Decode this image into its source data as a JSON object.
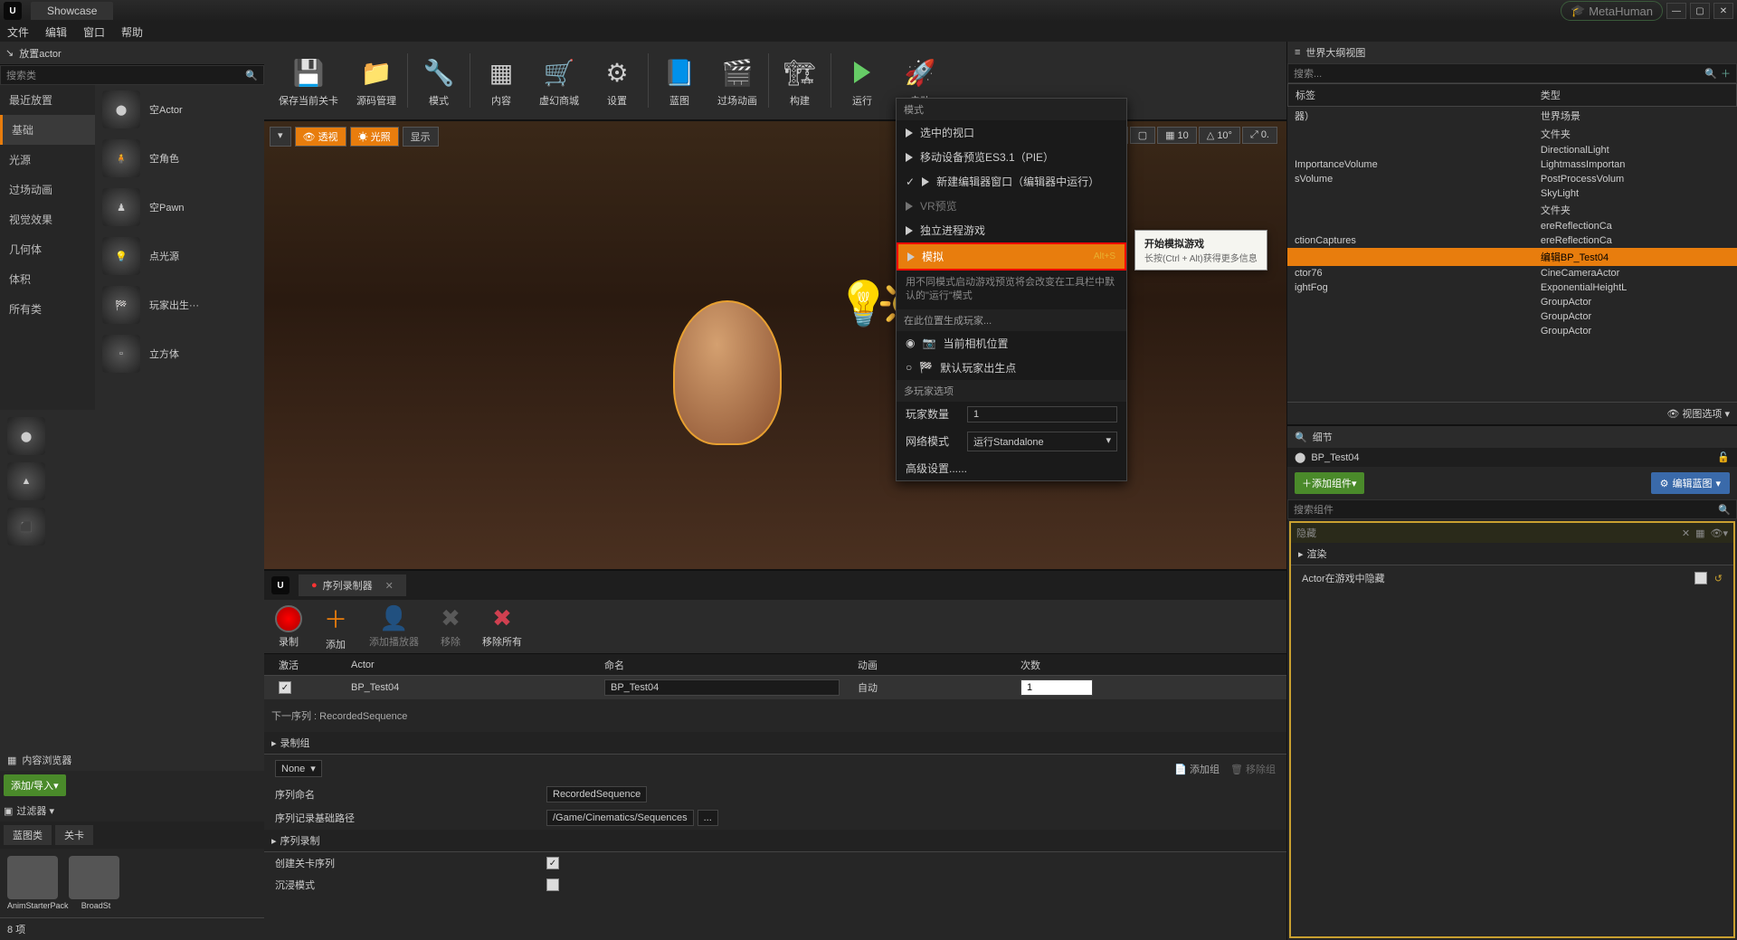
{
  "titlebar": {
    "tab": "Showcase",
    "metahuman": "MetaHuman"
  },
  "menubar": {
    "file": "文件",
    "edit": "编辑",
    "window": "窗口",
    "help": "帮助"
  },
  "place_actor": {
    "title": "放置actor",
    "search_placeholder": "搜索类",
    "categories": {
      "recent": "最近放置",
      "basic": "基础",
      "lights": "光源",
      "cinematic": "过场动画",
      "visual_fx": "视觉效果",
      "geometry": "几何体",
      "volumes": "体积",
      "all": "所有类"
    },
    "actors": {
      "empty_actor": "空Actor",
      "empty_character": "空角色",
      "empty_pawn": "空Pawn",
      "point_light": "点光源",
      "player_start": "玩家出生···",
      "cube": "立方体"
    }
  },
  "toolbar": {
    "save": "保存当前关卡",
    "source": "源码管理",
    "mode": "模式",
    "content": "内容",
    "marketplace": "虚幻商城",
    "settings": "设置",
    "blueprint": "蓝图",
    "cinematic": "过场动画",
    "build": "构建",
    "play": "运行",
    "launch": "启动"
  },
  "viewport": {
    "perspective": "透视",
    "lighting": "光照",
    "show": "显示",
    "snap_angle": "10°",
    "snap_grid": "10",
    "snap_scale": "0."
  },
  "play_menu": {
    "mode_section": "模式",
    "selected_viewport": "选中的视口",
    "mobile_preview": "移动设备预览ES3.1（PIE）",
    "new_editor_window": "新建编辑器窗口（编辑器中运行）",
    "vr_preview": "VR预览",
    "standalone": "独立进程游戏",
    "simulate": "模拟",
    "simulate_shortcut": "Alt+S",
    "desc1": "用不同模式启动游戏预览将会改变在工具栏中默认的\"运行\"模式",
    "spawn_section": "在此位置生成玩家...",
    "camera_location": "当前相机位置",
    "default_start": "默认玩家出生点",
    "multiplayer": "多玩家选项",
    "player_count": "玩家数量",
    "player_count_val": "1",
    "net_mode": "网络模式",
    "net_mode_val": "运行Standalone",
    "advanced": "高级设置......"
  },
  "tooltip": {
    "title": "开始模拟游戏",
    "desc": "长按(Ctrl + Alt)获得更多信息"
  },
  "outliner": {
    "title": "世界大纲视图",
    "search_placeholder": "搜索...",
    "col_label": "标签",
    "col_type": "类型",
    "rows": [
      {
        "label": "器）",
        "type": "世界场景"
      },
      {
        "label": "",
        "type": "文件夹"
      },
      {
        "label": "",
        "type": "DirectionalLight"
      },
      {
        "label": "ImportanceVolume",
        "type": "LightmassImportan"
      },
      {
        "label": "sVolume",
        "type": "PostProcessVolum"
      },
      {
        "label": "",
        "type": "SkyLight"
      },
      {
        "label": "",
        "type": "文件夹"
      },
      {
        "label": "",
        "type": "ereReflectionCa"
      },
      {
        "label": "ctionCaptures",
        "type": "ereReflectionCa"
      },
      {
        "label": "",
        "type": "编辑BP_Test04"
      },
      {
        "label": "ctor76",
        "type": "CineCameraActor"
      },
      {
        "label": "ightFog",
        "type": "ExponentialHeightL"
      },
      {
        "label": "",
        "type": "GroupActor"
      },
      {
        "label": "",
        "type": "GroupActor"
      },
      {
        "label": "",
        "type": "GroupActor"
      }
    ],
    "view_options": "视图选项"
  },
  "seq_recorder": {
    "tab": "序列录制器",
    "record": "录制",
    "add": "添加",
    "add_player": "添加播放器",
    "remove": "移除",
    "remove_all": "移除所有",
    "col_active": "激活",
    "col_actor": "Actor",
    "col_name": "命名",
    "col_anim": "动画",
    "col_count": "次数",
    "row_actor": "BP_Test04",
    "row_name": "BP_Test04",
    "row_anim": "自动",
    "row_count": "1",
    "next_seq": "下一序列 : RecordedSequence",
    "record_group": "录制组",
    "none": "None",
    "add_group": "添加组",
    "remove_group": "移除组",
    "seq_name": "序列命名",
    "seq_name_val": "RecordedSequence",
    "seq_path": "序列记录基础路径",
    "seq_path_val": "/Game/Cinematics/Sequences",
    "seq_recording": "序列录制",
    "create_level_seq": "创建关卡序列",
    "immersive": "沉浸模式"
  },
  "content_browser": {
    "title": "内容浏览器",
    "add_import": "添加/导入",
    "filter": "过滤器",
    "blueprint_class": "蓝图类",
    "level": "关卡",
    "folder1": "AnimStarterPack",
    "folder2": "BroadSt",
    "item_count": "8 项"
  },
  "details": {
    "title": "细节",
    "actor_name": "BP_Test04",
    "add_component": "添加组件",
    "edit_blueprint": "编辑蓝图",
    "search_placeholder": "搜索组件",
    "hidden": "隐藏",
    "render": "渲染",
    "actor_hidden_in_game": "Actor在游戏中隐藏"
  }
}
